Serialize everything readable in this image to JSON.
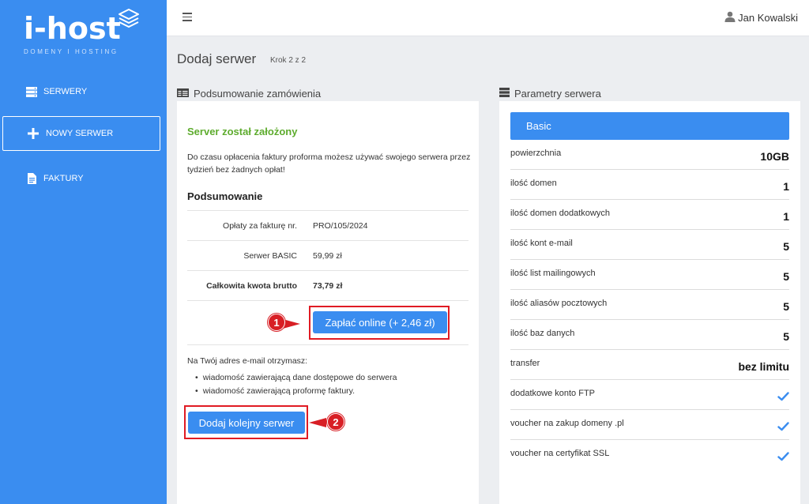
{
  "brand": {
    "name": "i-host",
    "tagline": "DOMENY I HOSTING"
  },
  "sidebar": {
    "items": [
      {
        "label": "SERWERY",
        "icon": "server-icon"
      },
      {
        "label": "NOWY SERWER",
        "icon": "plus-icon"
      },
      {
        "label": "FAKTURY",
        "icon": "document-icon"
      }
    ]
  },
  "topbar": {
    "user_name": "Jan Kowalski"
  },
  "page": {
    "title": "Dodaj serwer",
    "step": "Krok 2 z 2"
  },
  "order_summary": {
    "heading": "Podsumowanie zamówienia",
    "success_title": "Server został założony",
    "description": "Do czasu opłacenia faktury proforma możesz używać swojego serwera przez tydzień bez żadnych opłat!",
    "summary_title": "Podsumowanie",
    "rows": [
      {
        "label": "Opłaty za fakturę nr.",
        "value": "PRO/105/2024"
      },
      {
        "label": "Serwer BASIC",
        "value": "59,99 zł"
      },
      {
        "label": "Całkowita kwota brutto",
        "value": "73,79 zł"
      }
    ],
    "pay_button": "Zapłać online (+ 2,46 zł)",
    "email_intro": "Na Twój adres e-mail otrzymasz:",
    "email_items": [
      "wiadomość zawierającą dane dostępowe do serwera",
      "wiadomość zawierającą proformę faktury."
    ],
    "add_button": "Dodaj kolejny serwer",
    "callouts": [
      "1",
      "2"
    ]
  },
  "server_params": {
    "heading": "Parametry serwera",
    "plan": "Basic",
    "rows": [
      {
        "name": "powierzchnia",
        "value": "10GB"
      },
      {
        "name": "ilość domen",
        "value": "1"
      },
      {
        "name": "ilość domen dodatkowych",
        "value": "1"
      },
      {
        "name": "ilość kont e-mail",
        "value": "5"
      },
      {
        "name": "ilość list mailingowych",
        "value": "5"
      },
      {
        "name": "ilość aliasów pocztowych",
        "value": "5"
      },
      {
        "name": "ilość baz danych",
        "value": "5"
      },
      {
        "name": "transfer",
        "value": "bez limitu"
      },
      {
        "name": "dodatkowe konto FTP",
        "value": "check-icon"
      },
      {
        "name": "voucher na zakup domeny .pl",
        "value": "check-icon"
      },
      {
        "name": "voucher na certyfikat SSL",
        "value": "check-icon"
      }
    ]
  },
  "colors": {
    "primary": "#3a8df0",
    "success": "#5eac2e",
    "highlight": "#e01b24",
    "background": "#eceef1"
  }
}
